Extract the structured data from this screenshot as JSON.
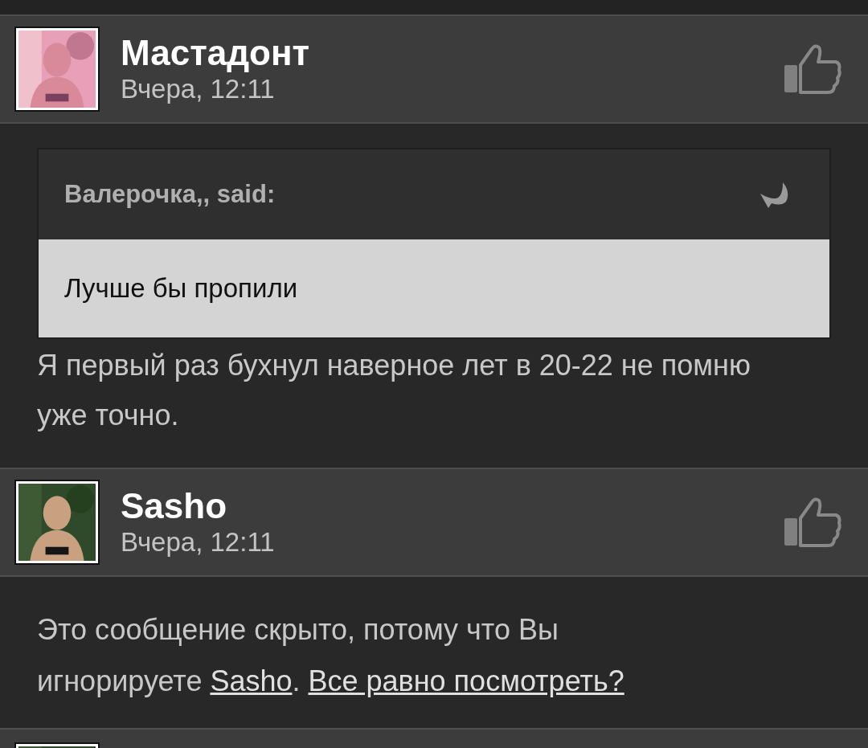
{
  "posts": [
    {
      "author": "Мастадонт",
      "time": "Вчера, 12:11",
      "kind": "quote_reply",
      "quote": {
        "attribution": "Валерочка,, said:",
        "text": "Лучше бы пропили"
      },
      "text": "Я первый раз бухнул наверное лет в 20-22 не помню уже точно."
    },
    {
      "author": "Sasho",
      "time": "Вчера, 12:11",
      "kind": "ignored",
      "notice": [
        {
          "kind": "text",
          "text": "Это сообщение скрыто, потому что Вы игнорируете "
        },
        {
          "kind": "link",
          "text": "Sasho"
        },
        {
          "kind": "text",
          "text": ". "
        },
        {
          "kind": "link",
          "text": "Все равно посмотреть?"
        }
      ]
    },
    {
      "kind": "partial"
    }
  ]
}
